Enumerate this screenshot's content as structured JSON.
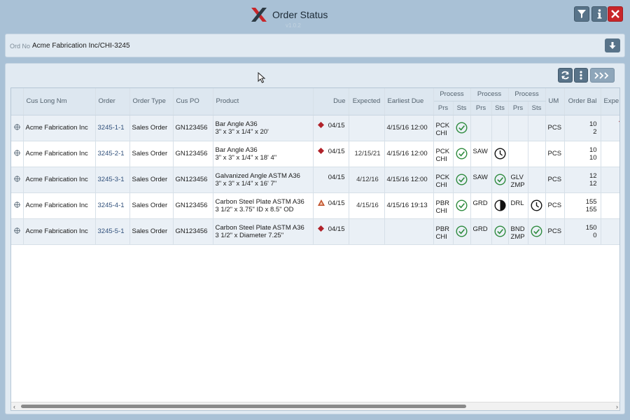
{
  "header": {
    "title": "Order Status",
    "subtitle": "v1.0.2"
  },
  "filter": {
    "label": "Ord No",
    "value": "Acme Fabrication Inc/CHI-3245"
  },
  "columns": {
    "cus_long_nm": "Cus Long Nm",
    "order": "Order",
    "order_type": "Order Type",
    "cus_po": "Cus PO",
    "product": "Product",
    "due": "Due",
    "expected": "Expected",
    "earliest_due": "Earliest Due",
    "process": "Process",
    "prs": "Prs",
    "sts": "Sts",
    "um": "UM",
    "order_bal": "Order Bal",
    "expe": "Expe"
  },
  "colors": {
    "accent": "#587389",
    "close": "#c8262a",
    "diamond": "#b0222a",
    "triangle": "#c0502a",
    "check": "#2e8b3e"
  },
  "rows": [
    {
      "customer": "Acme Fabrication Inc",
      "order": "3245-1-1",
      "order_type": "Sales Order",
      "cus_po": "GN123456",
      "product_1": "Bar Angle A36",
      "product_2": "3\" x 3\" x 1/4\" x 20'",
      "due_mark": "diamond",
      "due": "04/15",
      "expected": "",
      "earliest_due": "4/15/16 12:00",
      "p1_prs_1": "PCK",
      "p1_prs_2": "CHI",
      "p1_sts": "check-icon",
      "p2_prs_1": "",
      "p2_prs_2": "",
      "p2_sts": "",
      "p3_prs_1": "",
      "p3_prs_2": "",
      "p3_sts": "",
      "um": "PCS",
      "bal_1": "10",
      "bal_2": "2",
      "expe_mark": "diamond"
    },
    {
      "customer": "Acme Fabrication Inc",
      "order": "3245-2-1",
      "order_type": "Sales Order",
      "cus_po": "GN123456",
      "product_1": "Bar Angle A36",
      "product_2": "3\" x 3\" x 1/4\" x 18' 4\"",
      "due_mark": "diamond",
      "due": "04/15",
      "expected": "12/15/21",
      "earliest_due": "4/15/16 12:00",
      "p1_prs_1": "PCK",
      "p1_prs_2": "CHI",
      "p1_sts": "check-icon",
      "p2_prs_1": "SAW",
      "p2_prs_2": "",
      "p2_sts": "clock-icon",
      "p3_prs_1": "",
      "p3_prs_2": "",
      "p3_sts": "",
      "um": "PCS",
      "bal_1": "10",
      "bal_2": "10",
      "expe_mark": ""
    },
    {
      "customer": "Acme Fabrication Inc",
      "order": "3245-3-1",
      "order_type": "Sales Order",
      "cus_po": "GN123456",
      "product_1": "Galvanized Angle ASTM A36",
      "product_2": "3\" x 3\" x 1/4\" x 16' 7\"",
      "due_mark": "",
      "due": "04/15",
      "expected": "4/12/16",
      "earliest_due": "4/15/16 12:00",
      "p1_prs_1": "PCK",
      "p1_prs_2": "CHI",
      "p1_sts": "check-icon",
      "p2_prs_1": "SAW",
      "p2_prs_2": "",
      "p2_sts": "check-icon",
      "p3_prs_1": "GLV",
      "p3_prs_2": "ZMP",
      "p3_sts": "",
      "um": "PCS",
      "bal_1": "12",
      "bal_2": "12",
      "expe_mark": ""
    },
    {
      "customer": "Acme Fabrication Inc",
      "order": "3245-4-1",
      "order_type": "Sales Order",
      "cus_po": "GN123456",
      "product_1": "Carbon Steel Plate ASTM A36",
      "product_2": "3 1/2\" x 3.75\" ID x 8.5\" OD",
      "due_mark": "triangle",
      "due": "04/15",
      "expected": "4/15/16",
      "earliest_due": "4/15/16 19:13",
      "p1_prs_1": "PBR",
      "p1_prs_2": "CHI",
      "p1_sts": "check-icon",
      "p2_prs_1": "GRD",
      "p2_prs_2": "",
      "p2_sts": "half-circle-icon",
      "p3_prs_1": "DRL",
      "p3_prs_2": "",
      "p3_sts": "clock-icon",
      "um": "PCS",
      "bal_1": "155",
      "bal_2": "155",
      "expe_mark": ""
    },
    {
      "customer": "Acme Fabrication Inc",
      "order": "3245-5-1",
      "order_type": "Sales Order",
      "cus_po": "GN123456",
      "product_1": "Carbon Steel Plate ASTM A36",
      "product_2": "3 1/2\" x Diameter 7.25\"",
      "due_mark": "diamond",
      "due": "04/15",
      "expected": "",
      "earliest_due": "",
      "p1_prs_1": "PBR",
      "p1_prs_2": "CHI",
      "p1_sts": "check-icon",
      "p2_prs_1": "GRD",
      "p2_prs_2": "",
      "p2_sts": "check-icon",
      "p3_prs_1": "BND",
      "p3_prs_2": "ZMP",
      "p3_sts": "check-icon",
      "um": "PCS",
      "bal_1": "150",
      "bal_2": "0",
      "expe_mark": ""
    }
  ]
}
